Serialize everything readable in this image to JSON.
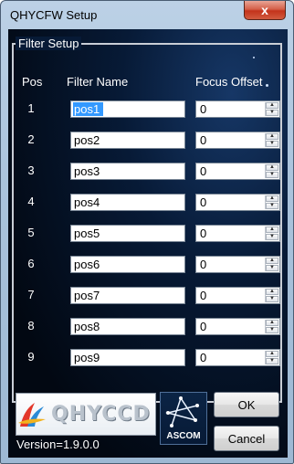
{
  "window": {
    "title": "QHYCFW Setup",
    "close_glyph": "x"
  },
  "group": {
    "label": "Filter Setup"
  },
  "headers": {
    "pos": "Pos",
    "name": "Filter Name",
    "offset": "Focus Offset"
  },
  "filters": [
    {
      "pos": "1",
      "name": "pos1",
      "offset": "0"
    },
    {
      "pos": "2",
      "name": "pos2",
      "offset": "0"
    },
    {
      "pos": "3",
      "name": "pos3",
      "offset": "0"
    },
    {
      "pos": "4",
      "name": "pos4",
      "offset": "0"
    },
    {
      "pos": "5",
      "name": "pos5",
      "offset": "0"
    },
    {
      "pos": "6",
      "name": "pos6",
      "offset": "0"
    },
    {
      "pos": "7",
      "name": "pos7",
      "offset": "0"
    },
    {
      "pos": "8",
      "name": "pos8",
      "offset": "0"
    },
    {
      "pos": "9",
      "name": "pos9",
      "offset": "0"
    }
  ],
  "footer": {
    "logo_text": "QHYCCD",
    "version": "Version=1.9.0.0",
    "ascom_label": "ASCOM",
    "ok_label": "OK",
    "cancel_label": "Cancel"
  },
  "colors": {
    "selection": "#3399ff",
    "client_bg": "#071a36"
  }
}
